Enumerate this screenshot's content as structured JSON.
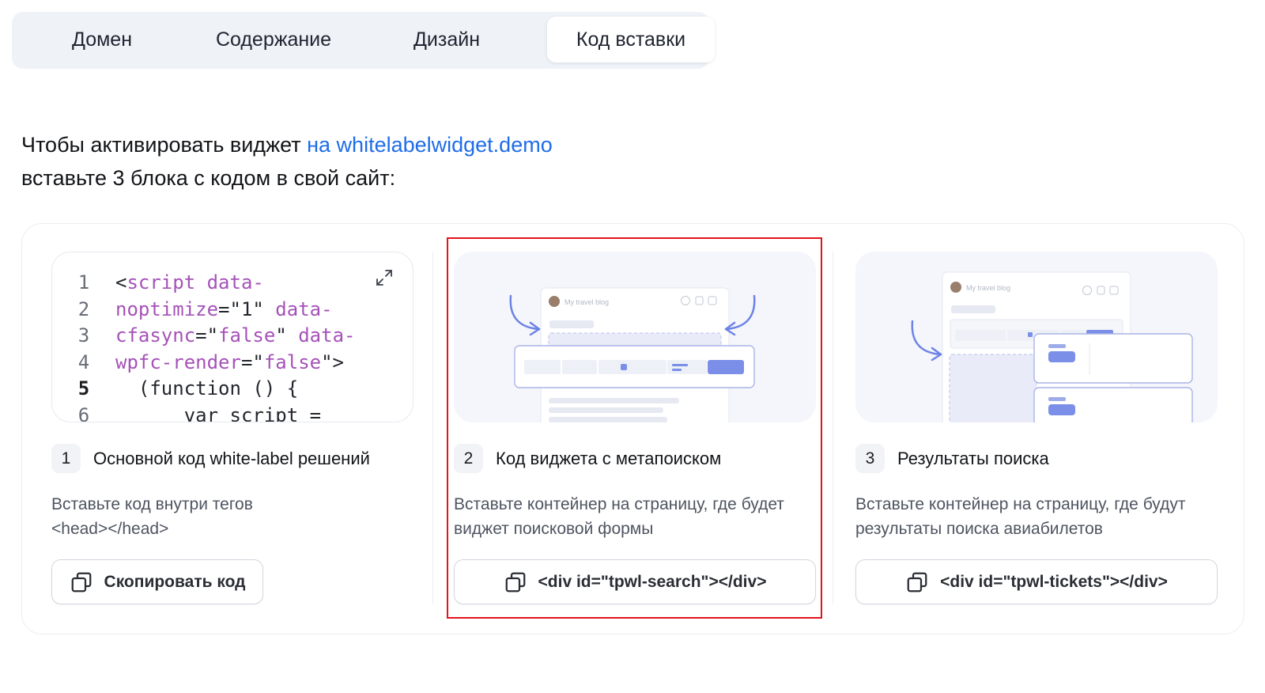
{
  "tabs": [
    {
      "label": "Домен",
      "active": false
    },
    {
      "label": "Содержание",
      "active": false
    },
    {
      "label": "Дизайн",
      "active": false
    },
    {
      "label": "Код вставки",
      "active": true
    }
  ],
  "intro": {
    "line1_prefix": "Чтобы активировать виджет ",
    "line1_link": "на whitelabelwidget.demo",
    "line2": "вставьте 3 блока с кодом в свой сайт:"
  },
  "code_preview": {
    "expand_icon": "expand-icon",
    "lines": [
      {
        "n": "1",
        "parts": [
          [
            "t",
            "<"
          ],
          [
            "k",
            "script data-"
          ]
        ]
      },
      {
        "n": "2",
        "parts": [
          [
            "k",
            "noptimize"
          ],
          [
            "t",
            "=\"1\" "
          ],
          [
            "k",
            "data-"
          ]
        ]
      },
      {
        "n": "3",
        "parts": [
          [
            "k",
            "cfasync"
          ],
          [
            "t",
            "=\""
          ],
          [
            "s",
            "false"
          ],
          [
            "t",
            "\" "
          ],
          [
            "k",
            "data-"
          ]
        ]
      },
      {
        "n": "4",
        "parts": [
          [
            "k",
            "wpfc-render"
          ],
          [
            "t",
            "=\""
          ],
          [
            "s",
            "false"
          ],
          [
            "t",
            "\">"
          ]
        ]
      },
      {
        "n": "5",
        "parts": [
          [
            "t",
            "  (function () {"
          ]
        ]
      },
      {
        "n": "6",
        "parts": [
          [
            "t",
            "      var script ="
          ]
        ]
      }
    ]
  },
  "blocks": [
    {
      "num": "1",
      "title": "Основной код white-label решений",
      "desc": "Вставьте код внутри тегов <head></head>",
      "button": "Скопировать код"
    },
    {
      "num": "2",
      "title": "Код виджета с метапоиском",
      "desc": "Вставьте контейнер на страницу, где будет виджет поисковой формы",
      "button": "<div id=\"tpwl-search\"></div>"
    },
    {
      "num": "3",
      "title": "Результаты поиска",
      "desc": "Вставьте контейнер на страницу, где будут результаты поиска авиабилетов",
      "button": "<div id=\"tpwl-tickets\"></div>"
    }
  ],
  "mockup": {
    "blog_title": "My travel blog"
  },
  "colors": {
    "accent": "#1f6de8",
    "highlight": "#e2131b",
    "code_keyword": "#a552b8",
    "mock_blue": "#7b8fe8"
  }
}
